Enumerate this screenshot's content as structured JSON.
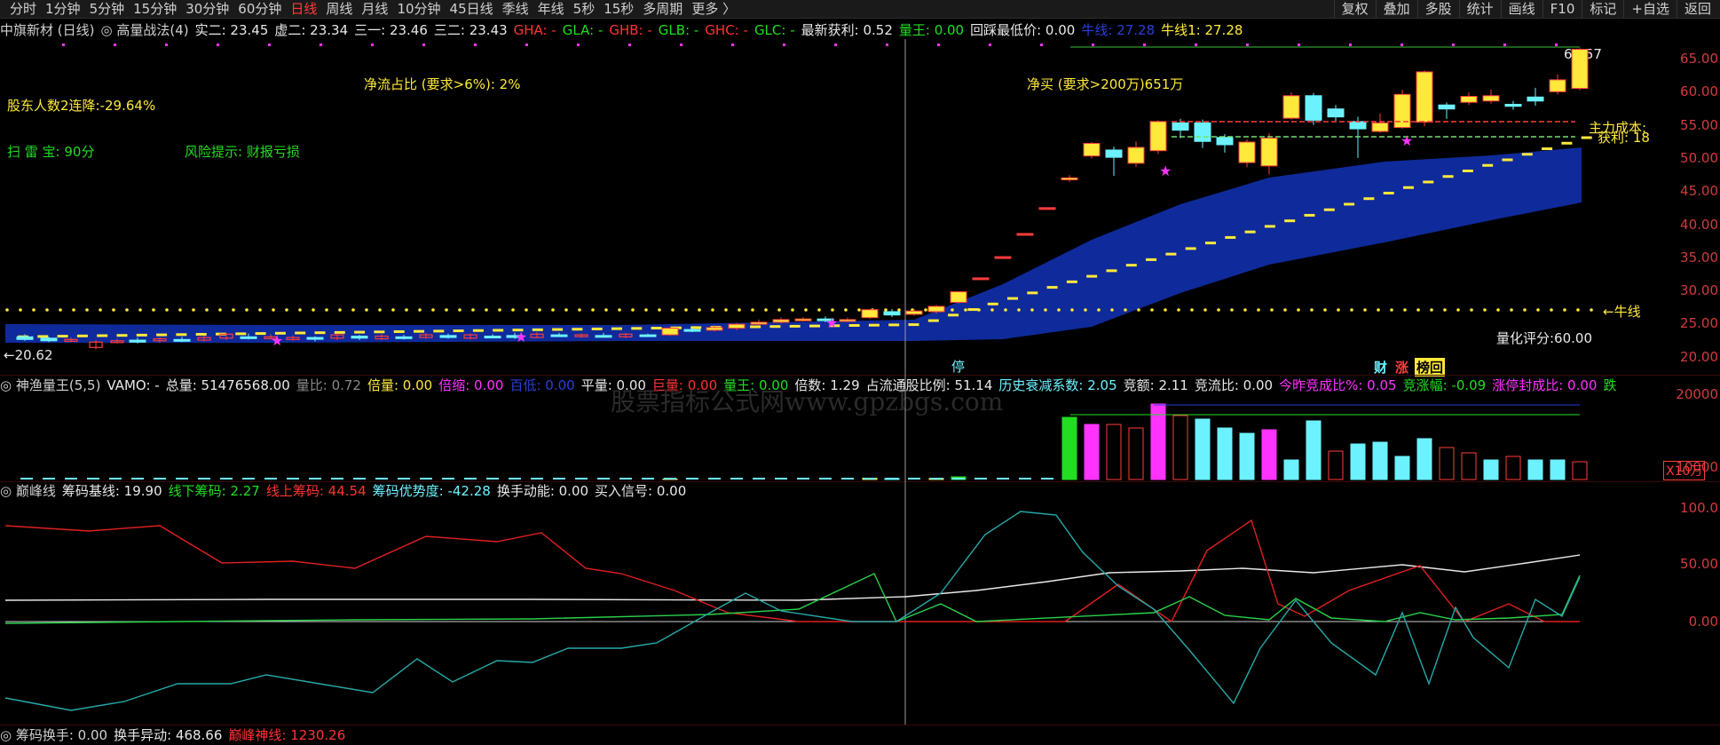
{
  "toolbar": {
    "tabs": [
      "分时",
      "1分钟",
      "5分钟",
      "15分钟",
      "30分钟",
      "60分钟",
      "日线",
      "周线",
      "月线",
      "10分钟",
      "45日线",
      "季线",
      "年线",
      "5秒",
      "15秒",
      "多周期",
      "更多 〉"
    ],
    "active": "日线",
    "right": [
      "复权",
      "叠加",
      "多股",
      "统计",
      "画线",
      "F10",
      "标记",
      "+自选",
      "返回"
    ]
  },
  "main": {
    "row": [
      {
        "t": "中旗新材 (日线)",
        "c": "#d0d0d0"
      },
      {
        "t": "◎ 高量战法(4)",
        "c": "#d0d0d0"
      },
      {
        "t": "实二: 23.45",
        "c": "#e8e8e8"
      },
      {
        "t": "虚二: 23.34",
        "c": "#e8e8e8"
      },
      {
        "t": "三一: 23.46",
        "c": "#e8e8e8"
      },
      {
        "t": "三二: 23.43",
        "c": "#e8e8e8"
      },
      {
        "t": "GHA: -",
        "c": "#ff3333"
      },
      {
        "t": "GLA: -",
        "c": "#22dd22"
      },
      {
        "t": "GHB: -",
        "c": "#ff3333"
      },
      {
        "t": "GLB: -",
        "c": "#22dd22"
      },
      {
        "t": "GHC: -",
        "c": "#ff3333"
      },
      {
        "t": "GLC: -",
        "c": "#22dd22"
      },
      {
        "t": "最新获利: 0.52",
        "c": "#e8e8e8"
      },
      {
        "t": "量王: 0.00",
        "c": "#22dd22"
      },
      {
        "t": "回踩最低价: 0.00",
        "c": "#e8e8e8"
      },
      {
        "t": "牛线: 27.28",
        "c": "#2a3fd8"
      },
      {
        "t": "牛线1: 27.28",
        "c": "#ffe93a"
      }
    ],
    "labels": {
      "holders": "股东人数2连降:-29.64%",
      "netflow": "净流占比 (要求>6%): 2%",
      "netbuy": "净买 (要求>200万)651万",
      "scan": "扫 雷 宝:   90分",
      "risk": "风险提示:   财报亏损",
      "high": "66.57",
      "cost": "主力成本:",
      "profit": "获利: 18",
      "bull": "←牛线",
      "low": "←20.62",
      "score": "量化评分:60.00",
      "ting": "停",
      "cai": "财",
      "zhang": "涨",
      "bang": "榜回"
    },
    "axis": [
      "65.00",
      "60.00",
      "55.00",
      "50.00",
      "45.00",
      "40.00",
      "35.00",
      "30.00",
      "25.00",
      "20.00"
    ]
  },
  "vol": {
    "row": [
      {
        "t": "◎ 神渔量王(5,5)",
        "c": "#d0d0d0"
      },
      {
        "t": "VAMO: -",
        "c": "#e8e8e8"
      },
      {
        "t": "总量: 51476568.00",
        "c": "#e8e8e8"
      },
      {
        "t": "量比: 0.72",
        "c": "#888888"
      },
      {
        "t": "倍量: 0.00",
        "c": "#ffe93a"
      },
      {
        "t": "倍缩: 0.00",
        "c": "#ff33ff"
      },
      {
        "t": "百低: 0.00",
        "c": "#2a3fd8"
      },
      {
        "t": "平量: 0.00",
        "c": "#e8e8e8"
      },
      {
        "t": "巨量: 0.00",
        "c": "#ff3333"
      },
      {
        "t": "量王: 0.00",
        "c": "#22dd22"
      },
      {
        "t": "倍数: 1.29",
        "c": "#e8e8e8"
      },
      {
        "t": "占流通股比例: 51.14",
        "c": "#e8e8e8"
      },
      {
        "t": "历史衰减系数: 2.05",
        "c": "#6cf2ff"
      },
      {
        "t": "竞额: 2.11",
        "c": "#e8e8e8"
      },
      {
        "t": "竞流比: 0.00",
        "c": "#e8e8e8"
      },
      {
        "t": "今昨竞成比%: 0.05",
        "c": "#ff33ff"
      },
      {
        "t": "竞涨幅: -0.09",
        "c": "#22dd22"
      },
      {
        "t": "涨停封成比: 0.00",
        "c": "#ff33ff"
      },
      {
        "t": "跌",
        "c": "#22dd22"
      }
    ],
    "axis": [
      "20000",
      "10000"
    ],
    "unit": "X10万",
    "watermark": "股票指标公式网www.gpzbgs.com"
  },
  "chip": {
    "row": [
      {
        "t": "◎ 巅峰线",
        "c": "#d0d0d0"
      },
      {
        "t": "筹码基线: 19.90",
        "c": "#e8e8e8"
      },
      {
        "t": "线下筹码: 2.27",
        "c": "#22dd22"
      },
      {
        "t": "线上筹码: 44.54",
        "c": "#ff3333"
      },
      {
        "t": "筹码优势度: -42.28",
        "c": "#6cf2ff"
      },
      {
        "t": "换手动能: 0.00",
        "c": "#e8e8e8"
      },
      {
        "t": "买入信号: 0.00",
        "c": "#e8e8e8"
      }
    ],
    "axis": [
      "100.0",
      "50.00",
      "0.00"
    ]
  },
  "bottom": {
    "row": [
      {
        "t": "◎ 筹码换手: 0.00",
        "c": "#d0d0d0"
      },
      {
        "t": "换手异动: 468.66",
        "c": "#e8e8e8"
      },
      {
        "t": "巅峰神线: 1230.26",
        "c": "#ff3333"
      }
    ]
  },
  "colors": {
    "up": "#ff3b3b",
    "down": "#6cf2ff",
    "yellow": "#ffe93a",
    "band": "#0f2a9a",
    "magenta": "#ff33ff",
    "green": "#22dd22"
  }
}
